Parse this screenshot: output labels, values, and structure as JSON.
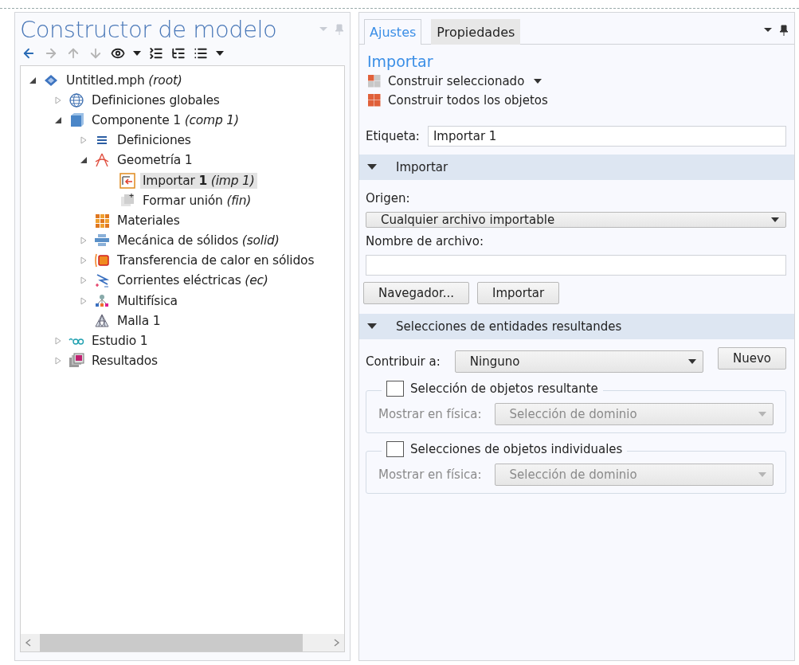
{
  "model_builder": {
    "title": "Constructor de modelo",
    "toolbar": [
      {
        "kind": "back",
        "disabled": false
      },
      {
        "kind": "forward",
        "disabled": true
      },
      {
        "kind": "up",
        "disabled": true
      },
      {
        "kind": "down",
        "disabled": true
      },
      {
        "kind": "show",
        "disabled": false
      },
      {
        "kind": "menu",
        "disabled": false
      },
      {
        "kind": "collapse",
        "disabled": false
      },
      {
        "kind": "expand",
        "disabled": false
      },
      {
        "kind": "list",
        "disabled": false
      },
      {
        "kind": "menu",
        "disabled": false
      }
    ],
    "tree": [
      {
        "label": "Untitled.mph *(root)*",
        "kind": "root",
        "expanded": true,
        "selected": false,
        "children": [
          {
            "label": "Definiciones globales",
            "kind": "globals",
            "expanded": false,
            "selected": false
          },
          {
            "label": "Componente 1 *(comp 1)*",
            "kind": "component",
            "expanded": true,
            "selected": false,
            "children": [
              {
                "label": "Definiciones",
                "kind": "definitions",
                "expanded": false,
                "selected": false
              },
              {
                "label": "Geometría 1",
                "kind": "geometry",
                "expanded": true,
                "selected": false,
                "children": [
                  {
                    "label": "Importar **1** *(imp 1)*",
                    "kind": "import",
                    "selected": true
                  },
                  {
                    "label": "Formar unión *(fin)*",
                    "kind": "union",
                    "selected": false
                  }
                ]
              },
              {
                "label": "Materiales",
                "kind": "materials",
                "selected": false
              },
              {
                "label": "Mecánica de sólidos *(solid)*",
                "kind": "solid",
                "expanded": false,
                "selected": false
              },
              {
                "label": "Transferencia de calor en sólidos",
                "kind": "heat",
                "expanded": false,
                "selected": false
              },
              {
                "label": "Corrientes eléctricas *(ec)*",
                "kind": "current",
                "expanded": false,
                "selected": false
              },
              {
                "label": "Multifísica",
                "kind": "multiphysics",
                "expanded": false,
                "selected": false
              },
              {
                "label": "Malla 1",
                "kind": "mesh",
                "selected": false
              }
            ]
          },
          {
            "label": "Estudio 1",
            "kind": "study",
            "expanded": false,
            "selected": false
          },
          {
            "label": "Resultados",
            "kind": "results",
            "expanded": false,
            "selected": false
          }
        ]
      }
    ]
  },
  "settings": {
    "tabs": [
      {
        "label": "Ajustes",
        "selected": true
      },
      {
        "label": "Propiedades",
        "selected": false
      }
    ],
    "heading": "Importar",
    "actions": [
      {
        "label": "Construir seleccionado",
        "kind": "selected",
        "has_menu": true
      },
      {
        "label": "Construir todos los objetos",
        "kind": "all",
        "has_menu": false
      }
    ],
    "label_field": {
      "label": "Etiqueta:",
      "value": "Importar 1"
    },
    "sections": [
      {
        "title": "Importar",
        "expanded": true,
        "kind": "import",
        "source_label": "Origen:",
        "source_value": "Cualquier archivo importable",
        "file_label": "Nombre de archivo:",
        "buttons": [
          "Navegador...",
          "Importar"
        ]
      },
      {
        "title": "Selecciones de entidades resultandes",
        "expanded": true,
        "kind": "selections",
        "contribute_label": "Contribuir a:",
        "contribute_value": "Ninguno",
        "new_button": "Nuevo",
        "groups": [
          {
            "label": "Selección de objetos resultante",
            "checked": false,
            "show_label": "Mostrar en física:",
            "show_value": "Selección de dominio",
            "disabled": true
          },
          {
            "label": "Selecciones de objetos individuales",
            "checked": false,
            "show_label": "Mostrar en física:",
            "show_value": "Selección de dominio",
            "disabled": true
          }
        ]
      }
    ]
  }
}
